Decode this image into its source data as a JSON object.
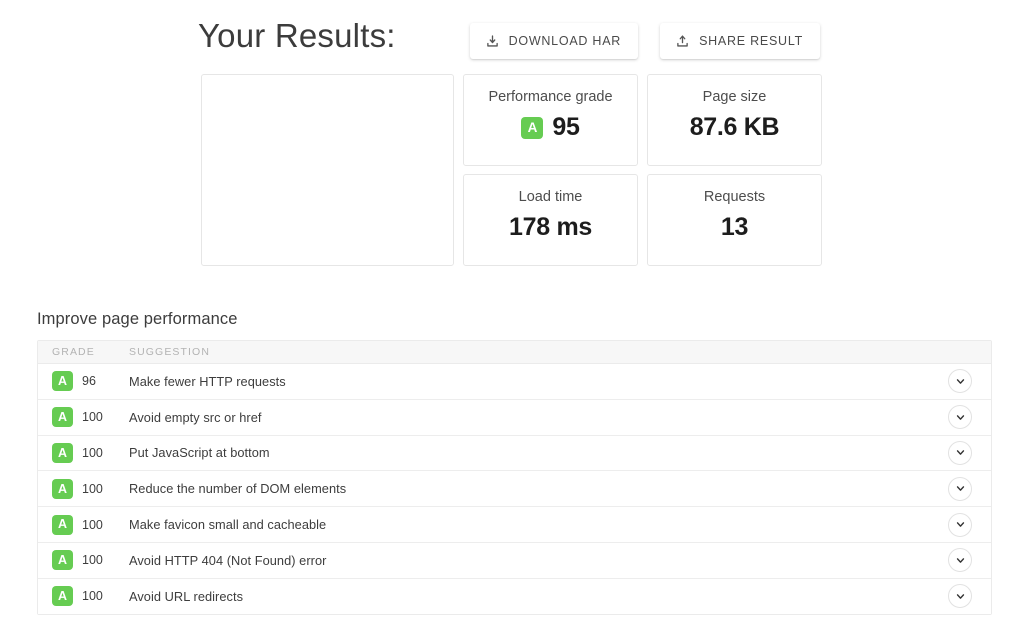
{
  "header": {
    "title": "Your Results:",
    "actions": [
      {
        "label": "DOWNLOAD HAR",
        "icon": "download-icon"
      },
      {
        "label": "SHARE RESULT",
        "icon": "share-upload-icon"
      }
    ]
  },
  "stats": {
    "thumbnail_placeholder": "",
    "cards": [
      {
        "label": "Performance grade",
        "value": "95",
        "badge": "A",
        "has_badge": true
      },
      {
        "label": "Page size",
        "value": "87.6 KB",
        "badge": "",
        "has_badge": false
      },
      {
        "label": "Load time",
        "value": "178 ms",
        "badge": "",
        "has_badge": false
      },
      {
        "label": "Requests",
        "value": "13",
        "badge": "",
        "has_badge": false
      }
    ]
  },
  "suggestions": {
    "section_title": "Improve page performance",
    "columns": {
      "grade": "GRADE",
      "suggestion": "SUGGESTION"
    },
    "rows": [
      {
        "badge": "A",
        "score": "96",
        "suggestion": "Make fewer HTTP requests"
      },
      {
        "badge": "A",
        "score": "100",
        "suggestion": "Avoid empty src or href"
      },
      {
        "badge": "A",
        "score": "100",
        "suggestion": "Put JavaScript at bottom"
      },
      {
        "badge": "A",
        "score": "100",
        "suggestion": "Reduce the number of DOM elements"
      },
      {
        "badge": "A",
        "score": "100",
        "suggestion": "Make favicon small and cacheable"
      },
      {
        "badge": "A",
        "score": "100",
        "suggestion": "Avoid HTTP 404 (Not Found) error"
      },
      {
        "badge": "A",
        "score": "100",
        "suggestion": "Avoid URL redirects"
      }
    ],
    "toggle_icon": "chevron-down-icon"
  },
  "colors": {
    "grade_green": "#66cc52",
    "text_primary": "#3d3d3d",
    "text_muted": "#b3b3b3",
    "border": "#ebebeb",
    "header_band": "#f7f7f7"
  }
}
